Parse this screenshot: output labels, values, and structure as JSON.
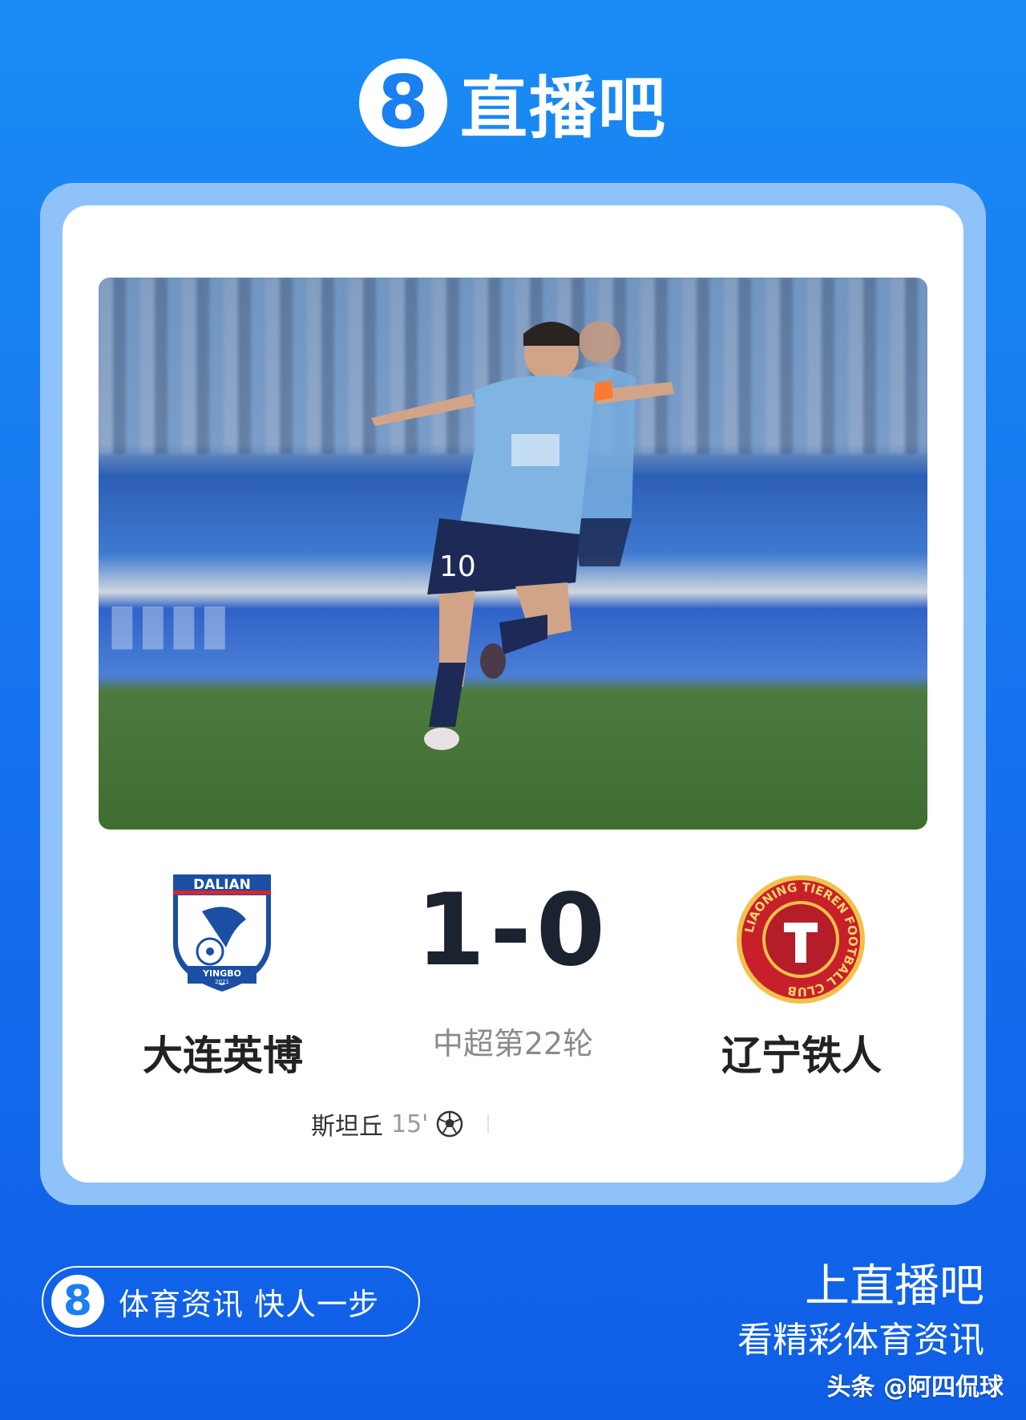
{
  "header": {
    "brand_badge": "8",
    "brand_name": "直播吧"
  },
  "match": {
    "home_team": "大连英博",
    "away_team": "辽宁铁人",
    "score": "1-0",
    "round": "中超第22轮",
    "scorers": [
      {
        "name": "斯坦丘",
        "minute": "15'",
        "icon": "soccer-ball-icon"
      }
    ]
  },
  "logos": {
    "home": {
      "top_text": "DALIAN",
      "bottom_text": "YINGBO",
      "year": "2021"
    },
    "away": {
      "ring_text": "LIAONING TIEREN FOOTBALL CLUB"
    }
  },
  "footer": {
    "slogan_badge": "8",
    "slogan": "体育资讯 快人一步",
    "title": "上直播吧",
    "subtitle": "看精彩体育资讯",
    "watermark": "头条 @阿四侃球"
  },
  "colors": {
    "background": "#1570ee",
    "card_frame": "#8fc2f9",
    "home_blue": "#1a4fa3",
    "away_red": "#c8202b"
  }
}
